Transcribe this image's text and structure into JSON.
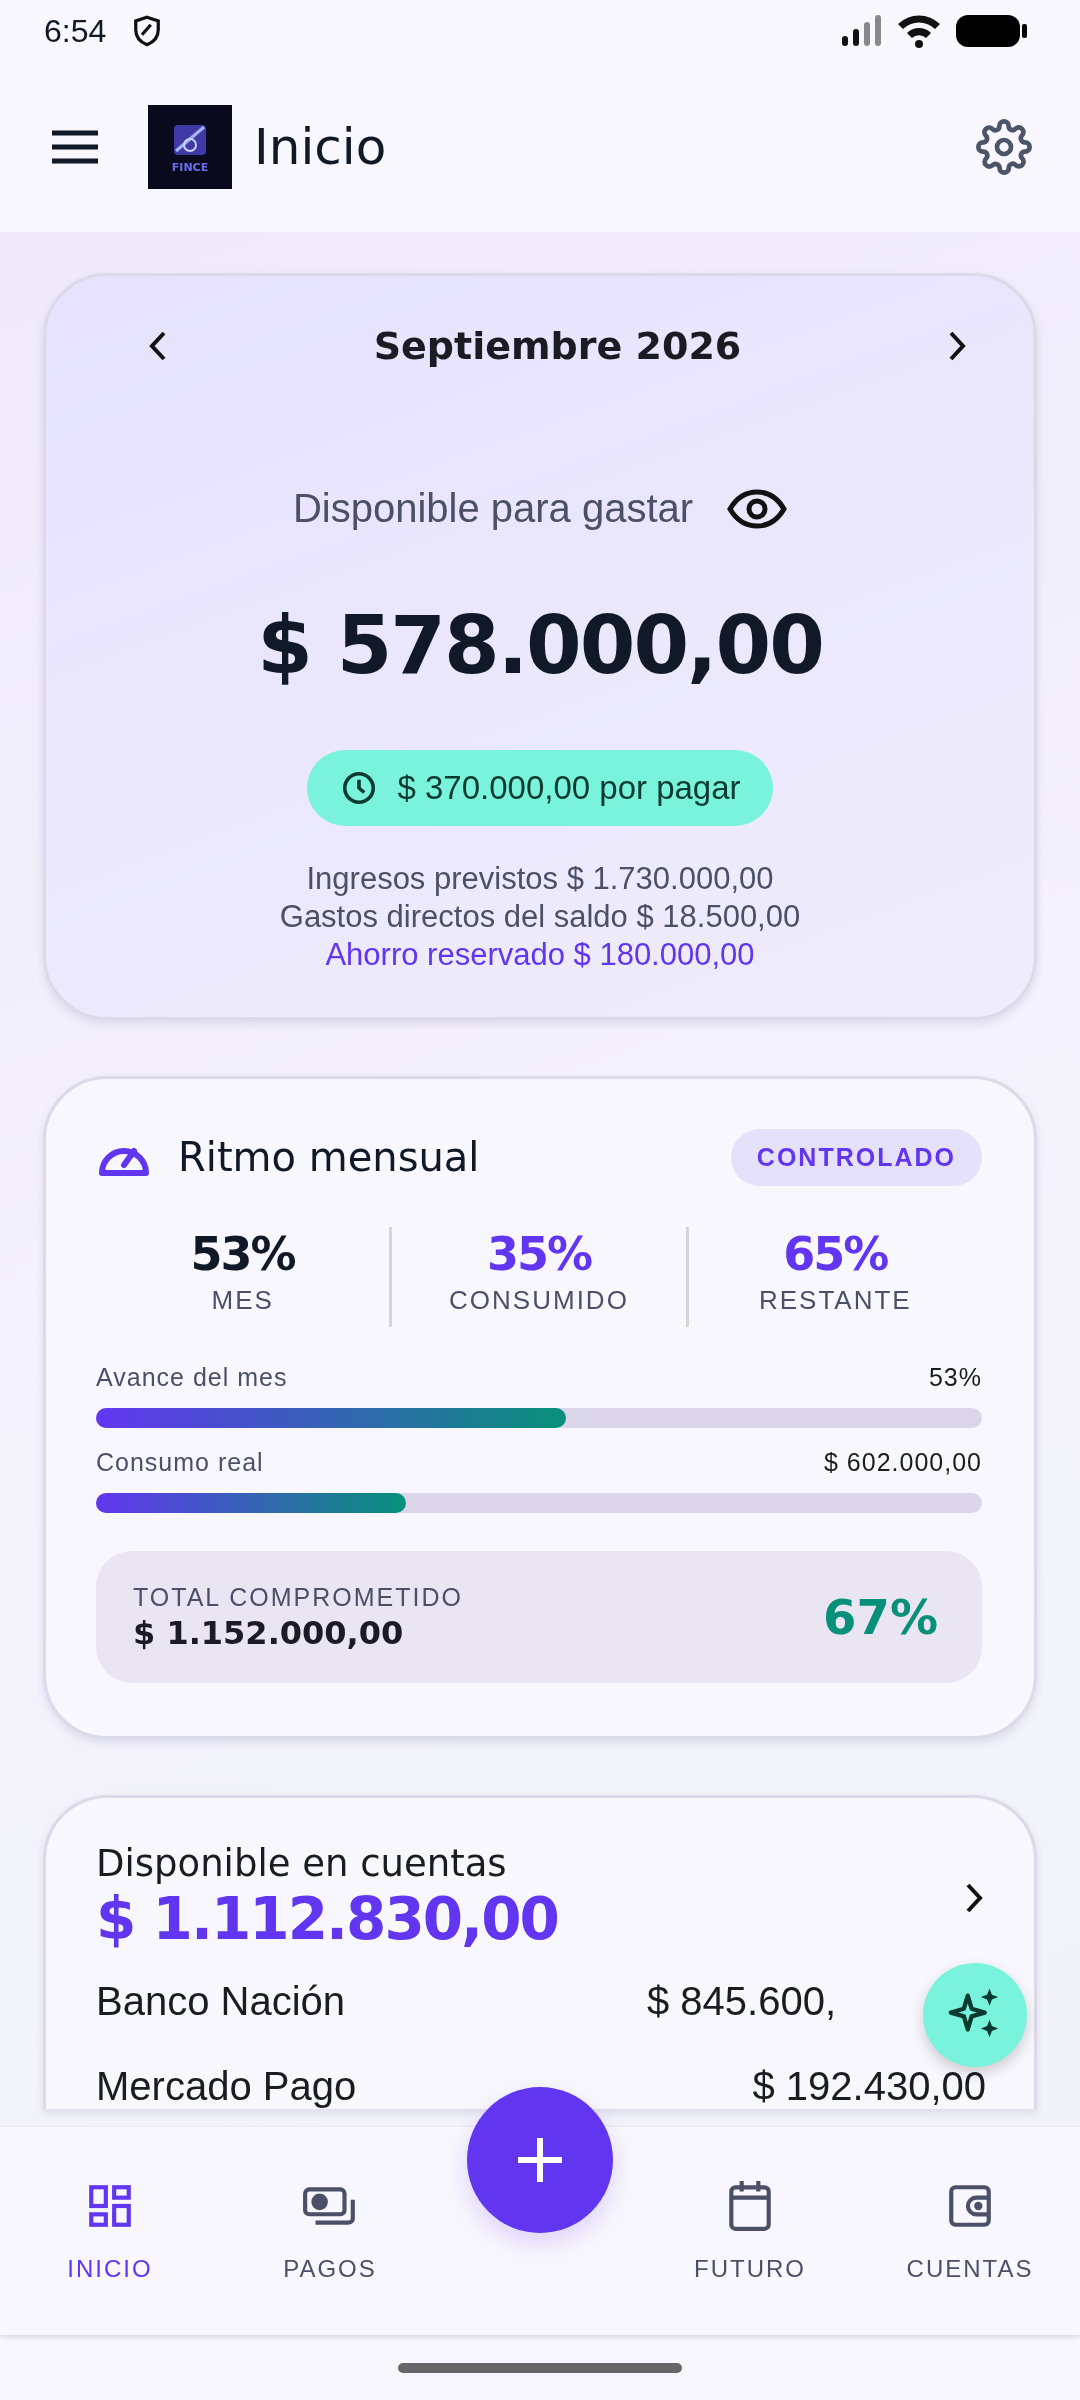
{
  "status_bar": {
    "time": "6:54"
  },
  "app_bar": {
    "logo_text": "FINCE",
    "title": "Inicio"
  },
  "balance_card": {
    "month": "Septiembre 2026",
    "label": "Disponible para gastar",
    "amount": "$ 578.000,00",
    "pending": "$ 370.000,00 por pagar",
    "details": [
      {
        "text": "Ingresos previstos $ 1.730.000,00",
        "kind": "normal"
      },
      {
        "text": "Gastos directos del saldo $ 18.500,00",
        "kind": "normal"
      },
      {
        "text": "Ahorro reservado $ 180.000,00",
        "kind": "savings"
      }
    ]
  },
  "pace_card": {
    "title": "Ritmo mensual",
    "status": "CONTROLADO",
    "stats": [
      {
        "value": "53%",
        "label": "MES",
        "kind": "neutral"
      },
      {
        "value": "35%",
        "label": "CONSUMIDO",
        "kind": "accent"
      },
      {
        "value": "65%",
        "label": "RESTANTE",
        "kind": "accent"
      }
    ],
    "bars": [
      {
        "label": "Avance del mes",
        "reading": "53%",
        "level": 0.53
      },
      {
        "label": "Consumo real",
        "reading": "$ 602.000,00",
        "level": 0.35
      }
    ],
    "total": {
      "label": "TOTAL COMPROMETIDO",
      "amount": "$ 1.152.000,00",
      "percent": "67%"
    }
  },
  "accounts_card": {
    "title": "Disponible en cuentas",
    "total": "$ 1.112.830,00",
    "accounts": [
      {
        "name": "Banco Nación",
        "amount": "$ 845.600,"
      },
      {
        "name": "Mercado Pago",
        "amount": "$ 192.430,00"
      }
    ]
  },
  "nav": {
    "items": [
      {
        "label": "INICIO",
        "selected": true
      },
      {
        "label": "PAGOS",
        "selected": false
      },
      {
        "label": "FUTURO",
        "selected": false
      },
      {
        "label": "CUENTAS",
        "selected": false
      }
    ]
  }
}
